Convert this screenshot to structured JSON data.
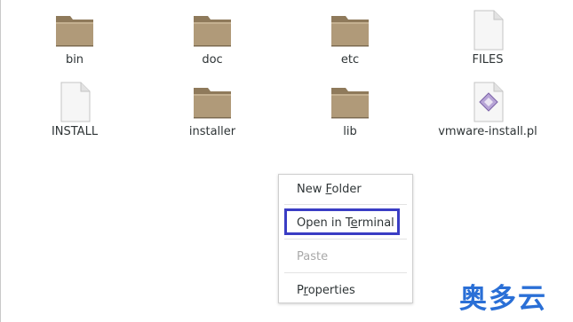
{
  "files": [
    {
      "name": "bin",
      "type": "folder",
      "icon": "folder-icon"
    },
    {
      "name": "doc",
      "type": "folder",
      "icon": "folder-icon"
    },
    {
      "name": "etc",
      "type": "folder",
      "icon": "folder-icon"
    },
    {
      "name": "FILES",
      "type": "file",
      "icon": "document-icon"
    },
    {
      "name": "INSTALL",
      "type": "file",
      "icon": "document-icon"
    },
    {
      "name": "installer",
      "type": "folder",
      "icon": "folder-icon"
    },
    {
      "name": "lib",
      "type": "folder",
      "icon": "folder-icon"
    },
    {
      "name": "vmware-install.pl",
      "type": "script",
      "icon": "script-icon"
    }
  ],
  "context_menu": {
    "new_folder": {
      "before": "New ",
      "accel": "F",
      "after": "older"
    },
    "open_terminal": {
      "before": "Open in T",
      "accel": "e",
      "after": "rminal"
    },
    "paste": {
      "label": "Paste",
      "disabled": true
    },
    "properties": {
      "before": "P",
      "accel": "r",
      "after": "operties"
    }
  },
  "watermark": "奥多云",
  "colors": {
    "highlight_border": "#3a3dc4",
    "folder": "#b09a79",
    "watermark": "#2a6fd6"
  }
}
